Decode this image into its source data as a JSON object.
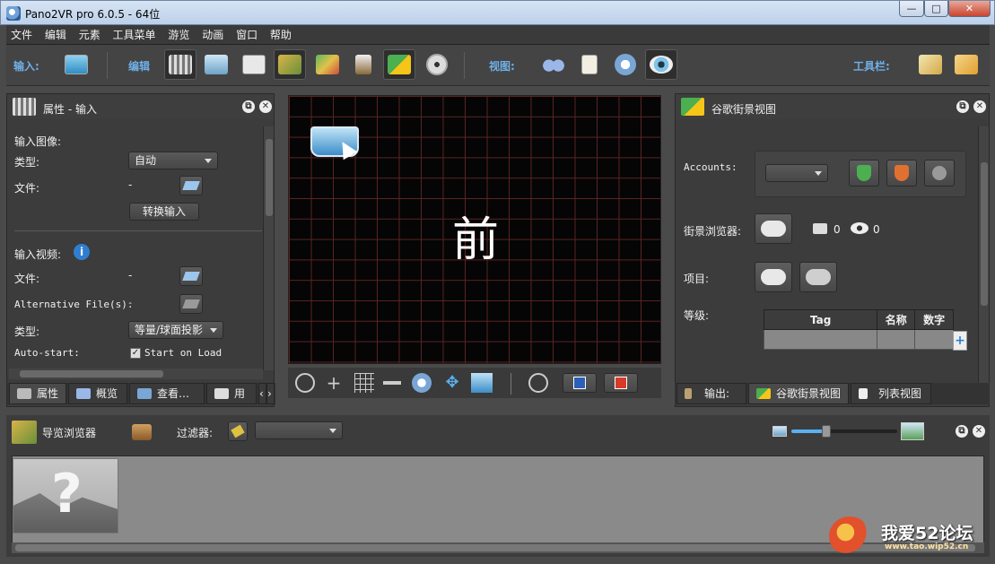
{
  "window": {
    "title": "Pano2VR pro 6.0.5 - 64位"
  },
  "menu": [
    "文件",
    "编辑",
    "元素",
    "工具菜单",
    "游览",
    "动画",
    "窗口",
    "帮助"
  ],
  "toolbar": {
    "input_label": "输入:",
    "edit_label": "编辑",
    "view_label": "视图:",
    "toolbars_label": "工具栏:"
  },
  "properties": {
    "title": "属性 - 输入",
    "input_image_header": "输入图像:",
    "type_label": "类型:",
    "type_value": "自动",
    "file_label": "文件:",
    "file_value": "-",
    "convert_button": "转换输入",
    "input_video_header": "输入视频:",
    "video_file_label": "文件:",
    "video_file_value": "-",
    "alt_files_label": "Alternative File(s):",
    "alt_files_value": "-",
    "video_type_label": "类型:",
    "video_type_value": "等量/球面投影",
    "autostart_label": "Auto-start:",
    "autostart_checkbox": "Start on Load",
    "tabs": [
      "属性",
      "概览",
      "查看…",
      "用"
    ]
  },
  "viewer": {
    "overlay_text": "前"
  },
  "streetview": {
    "title": "谷歌街景视图",
    "accounts_label": "Accounts:",
    "browser_label": "街景浏览器:",
    "photo_count": "0",
    "view_count": "0",
    "project_label": "项目:",
    "level_label": "等级:",
    "table_headers": [
      "Tag",
      "名称",
      "数字"
    ],
    "tabs": [
      "输出:",
      "谷歌街景视图",
      "列表视图"
    ]
  },
  "tour_browser": {
    "title": "导览浏览器",
    "filter_label": "过滤器:"
  },
  "watermark": {
    "text": "我爱52论坛",
    "url": "www.tao.wip52.cn"
  },
  "colors": {
    "accent": "#6fb0e8",
    "panel": "#3c3c3c",
    "grid": "#5a2424"
  }
}
